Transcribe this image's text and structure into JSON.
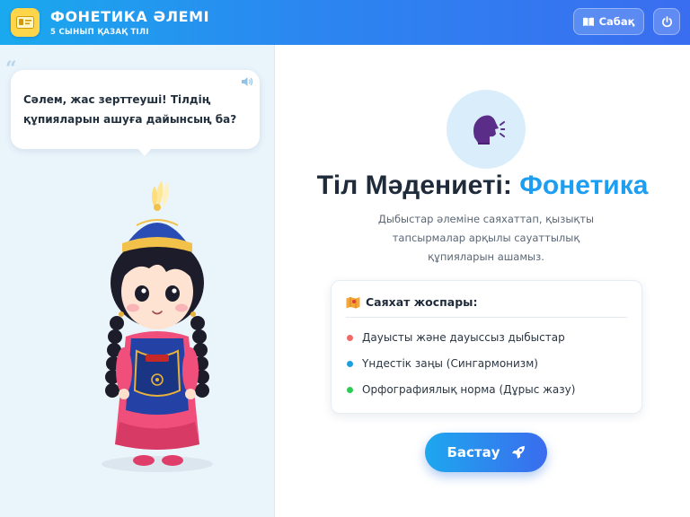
{
  "header": {
    "title": "ФОНЕТИКА ӘЛЕМІ",
    "subtitle": "5 СЫНЫП ҚАЗАҚ ТІЛІ",
    "lesson_button": "Сабақ",
    "icons": {
      "logo": "id-card-icon",
      "lesson": "book-icon",
      "power": "power-icon"
    }
  },
  "speech": {
    "text": "Сәлем, жас зерттеуші! Тілдің құпияларын ашуға дайынсың ба?",
    "icon": "speaker-icon"
  },
  "hero": {
    "title_main": "Тіл Мәдениеті: ",
    "title_accent": "Фонетика",
    "description": "Дыбыстар әлеміне саяхаттап, қызықты тапсырмалар арқылы сауаттылық құпияларын ашамыз.",
    "emblem_icon": "speaking-head-icon"
  },
  "plan": {
    "title": "Саяхат жоспары:",
    "icon": "map-icon",
    "items": [
      {
        "label": "Дауысты және дауыссыз дыбыстар",
        "color": "#f06a6a"
      },
      {
        "label": "Үндестік заңы (Сингармонизм)",
        "color": "#1ea0e0"
      },
      {
        "label": "Орфографиялық норма (Дұрыс жазу)",
        "color": "#2ecc55"
      }
    ]
  },
  "start_button": {
    "label": "Бастау",
    "icon": "rocket-icon"
  },
  "colors": {
    "accent": "#1d9ef0",
    "header_from": "#1aa9ee",
    "header_to": "#3a6df0"
  }
}
